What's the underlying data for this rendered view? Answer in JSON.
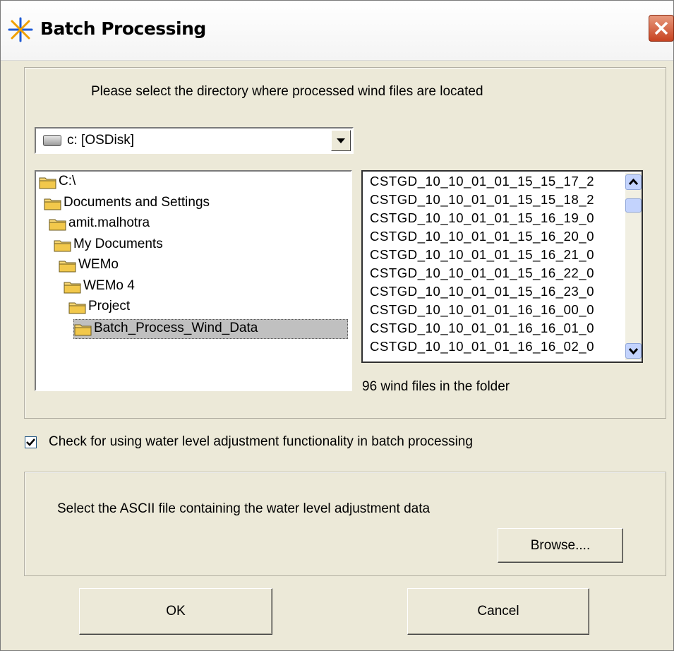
{
  "window": {
    "title": "Batch Processing"
  },
  "directory_group": {
    "instruction": "Please select the directory where processed wind files are located",
    "drive": "c: [OSDisk]",
    "tree": [
      {
        "label": "C:\\",
        "indent": 0,
        "selected": false
      },
      {
        "label": "Documents and Settings",
        "indent": 1,
        "selected": false
      },
      {
        "label": "amit.malhotra",
        "indent": 2,
        "selected": false
      },
      {
        "label": "My Documents",
        "indent": 3,
        "selected": false
      },
      {
        "label": "WEMo",
        "indent": 4,
        "selected": false
      },
      {
        "label": "WEMo 4",
        "indent": 5,
        "selected": false
      },
      {
        "label": "Project",
        "indent": 6,
        "selected": false
      },
      {
        "label": "Batch_Process_Wind_Data",
        "indent": 7,
        "selected": true
      }
    ],
    "files": [
      "CSTGD_10_10_01_01_15_15_17_2",
      "CSTGD_10_10_01_01_15_15_18_2",
      "CSTGD_10_10_01_01_15_16_19_0",
      "CSTGD_10_10_01_01_15_16_20_0",
      "CSTGD_10_10_01_01_15_16_21_0",
      "CSTGD_10_10_01_01_15_16_22_0",
      "CSTGD_10_10_01_01_15_16_23_0",
      "CSTGD_10_10_01_01_16_16_00_0",
      "CSTGD_10_10_01_01_16_16_01_0",
      "CSTGD_10_10_01_01_16_16_02_0"
    ],
    "file_count": "96 wind files in the folder"
  },
  "water_level": {
    "checkbox_label": "Check for using water level adjustment functionality in batch processing",
    "checked": true,
    "instruction": "Select the ASCII file containing the water level adjustment data",
    "browse_label": "Browse...."
  },
  "buttons": {
    "ok": "OK",
    "cancel": "Cancel"
  }
}
